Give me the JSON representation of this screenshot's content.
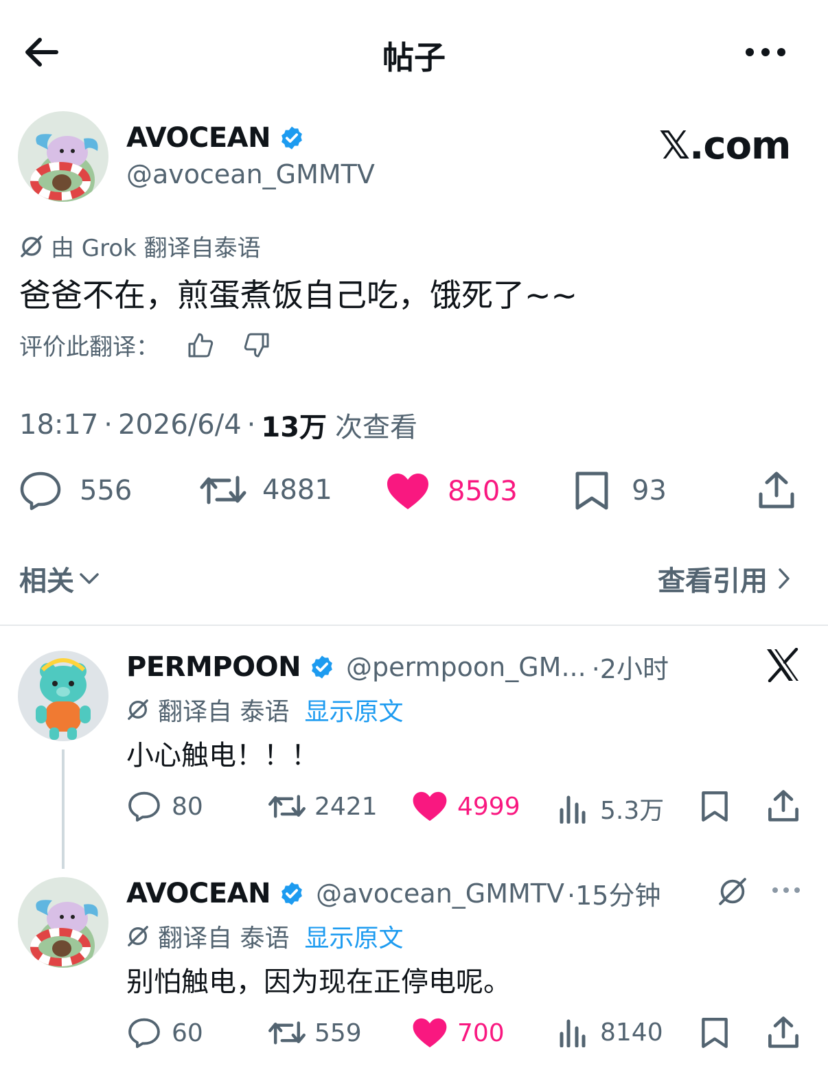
{
  "header": {
    "title": "帖子"
  },
  "main_post": {
    "author_name": "AVOCEAN",
    "author_handle": "@avocean_GMMTV",
    "brand_logo": "𝕏.com",
    "translation_note": "由 Grok 翻译自泰语",
    "text": "爸爸不在，煎蛋煮饭自己吃，饿死了~~",
    "rate_label": "评价此翻译：",
    "time": "18:17",
    "date": "2026/6/4",
    "views_count": "13万",
    "views_label": "次查看",
    "replies": "556",
    "reposts": "4881",
    "likes": "8503",
    "bookmarks": "93"
  },
  "related": {
    "label": "相关",
    "quotes_label": "查看引用"
  },
  "replies": [
    {
      "author_name": "PERMPOON",
      "author_handle": "@permpoon_GM...",
      "time": "·2小时",
      "translated_from": "翻译自 泰语",
      "show_original": "显示原文",
      "text": "小心触电！！！",
      "replies": "80",
      "reposts": "2421",
      "likes": "4999",
      "views": "5.3万"
    },
    {
      "author_name": "AVOCEAN",
      "author_handle": "@avocean_GMMTV",
      "time": "·15分钟",
      "translated_from": "翻译自 泰语",
      "show_original": "显示原文",
      "text": "别怕触电，因为现在正停电呢。",
      "replies": "60",
      "reposts": "559",
      "likes": "700",
      "views": "8140"
    }
  ],
  "colors": {
    "like": "#f91880",
    "verified": "#1d9bf0",
    "muted": "#536471",
    "link": "#1d9bf0"
  }
}
